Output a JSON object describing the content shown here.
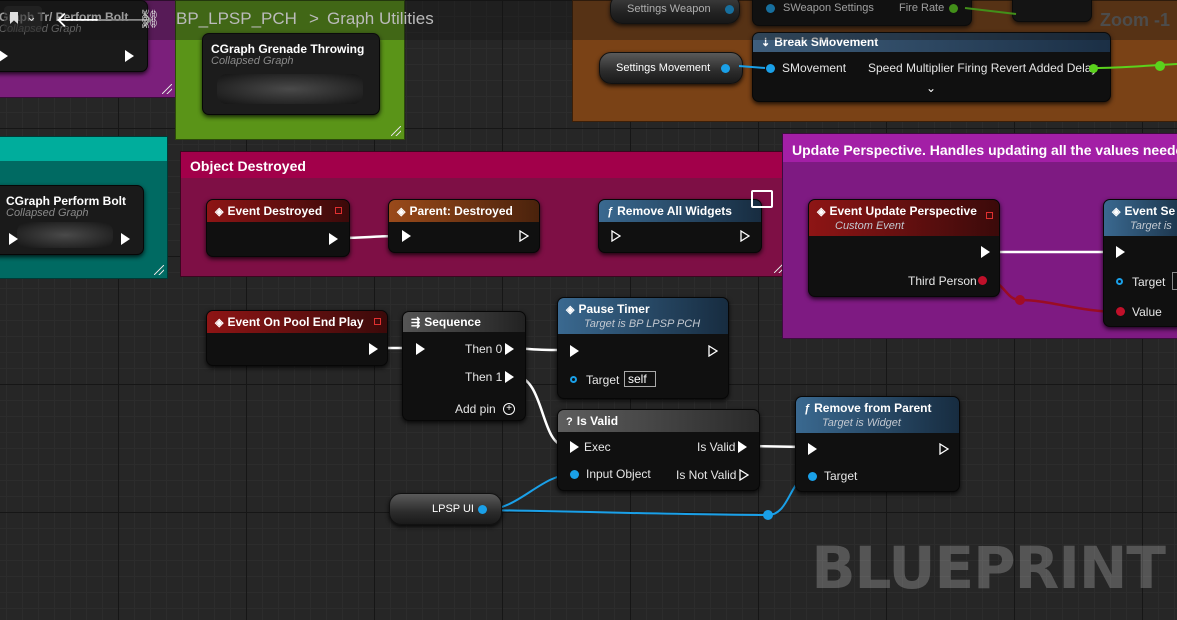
{
  "toolbar": {
    "breadcrumb_asset": "BP_LPSP_PCH",
    "breadcrumb_separator": ">",
    "breadcrumb_graph": "Graph Utilities",
    "zoom_label": "Zoom -1"
  },
  "watermark": "BLUEPRINT",
  "collapsed_graphs": [
    {
      "title": "Graph Tr/ Perform Bolt",
      "subtitle": "Collapsed Graph"
    },
    {
      "title": "CGraph Grenade Throwing",
      "subtitle": "Collapsed Graph"
    },
    {
      "title": "CGraph Perform Bolt",
      "subtitle": "Collapsed Graph"
    }
  ],
  "comments": {
    "object_destroyed": "Object Destroyed",
    "update_perspective": "Update Perspective. Handles updating all the values needed f"
  },
  "top_area": {
    "settings_weapon_label": "Settings Weapon",
    "sweapon_settings_label": "SWeapon Settings",
    "fire_rate_label": "Fire Rate",
    "settings_movement_label": "Settings Movement",
    "break_node_title": "Break SMovement",
    "smovement_pin": "SMovement",
    "speed_multiplier_pin": "Speed Multiplier Firing Revert Added Delay"
  },
  "nodes": {
    "event_destroyed": {
      "title": "Event Destroyed"
    },
    "parent_destroyed": {
      "title": "Parent: Destroyed"
    },
    "remove_all_widgets": {
      "title": "Remove All Widgets"
    },
    "event_update_perspective": {
      "title": "Event Update Perspective",
      "subtitle": "Custom Event",
      "pin_third_person": "Third Person"
    },
    "event_set": {
      "title": "Event Se",
      "subtitle": "Target is",
      "pin_target": "Target",
      "pin_value": "Value"
    },
    "event_on_pool_end_play": {
      "title": "Event On Pool End Play"
    },
    "sequence": {
      "title": "Sequence",
      "then0": "Then 0",
      "then1": "Then 1",
      "add_pin": "Add pin"
    },
    "pause_timer": {
      "title": "Pause Timer",
      "subtitle": "Target is BP LPSP PCH",
      "pin_target": "Target",
      "target_value": "self"
    },
    "is_valid": {
      "title": "Is Valid",
      "pin_exec": "Exec",
      "pin_input": "Input Object",
      "out_valid": "Is Valid",
      "out_not_valid": "Is Not Valid"
    },
    "remove_from_parent": {
      "title": "Remove from Parent",
      "subtitle": "Target is Widget",
      "pin_target": "Target"
    },
    "lpsp_ui": {
      "title": "LPSP UI"
    }
  },
  "colors": {
    "comment_red": "#a8004a",
    "comment_purple": "#8a1a8a",
    "comment_orange": "#8a4a18",
    "comment_green": "#5e9a1a",
    "comment_teal": "#009b8c",
    "event_header": "#8e1515",
    "function_header": "#3c6e91",
    "object_pin": "#1aa0e8",
    "bool_pin": "#c0102a",
    "float_pin": "#5bd21c"
  }
}
